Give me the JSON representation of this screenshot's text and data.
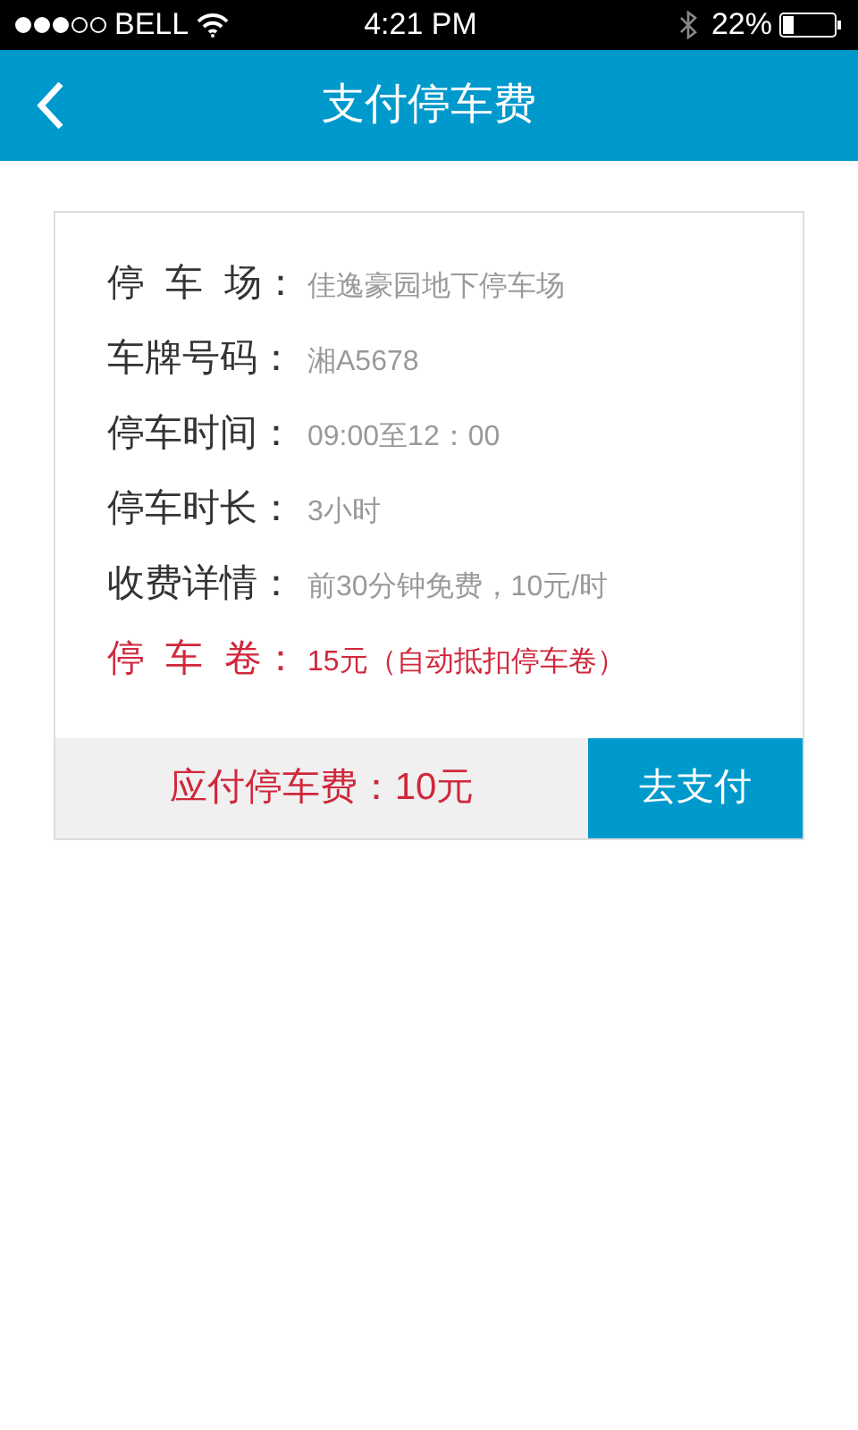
{
  "status_bar": {
    "carrier": "BELL",
    "time": "4:21 PM",
    "battery": "22%"
  },
  "nav": {
    "title": "支付停车费"
  },
  "details": [
    {
      "label": "停  车  场：",
      "value": "佳逸豪园地下停车场",
      "kind": "normal"
    },
    {
      "label": "车牌号码：",
      "value": "湘A5678",
      "kind": "normal"
    },
    {
      "label": "停车时间：",
      "value": "09:00至12：00",
      "kind": "normal"
    },
    {
      "label": "停车时长：",
      "value": "3小时",
      "kind": "normal"
    },
    {
      "label": "收费详情：",
      "value": "前30分钟免费，10元/时",
      "kind": "normal"
    },
    {
      "label": "停  车  卷：",
      "value": "15元（自动抵扣停车卷）",
      "kind": "highlight"
    }
  ],
  "footer": {
    "amount": "应付停车费：10元",
    "pay_button": "去支付"
  }
}
